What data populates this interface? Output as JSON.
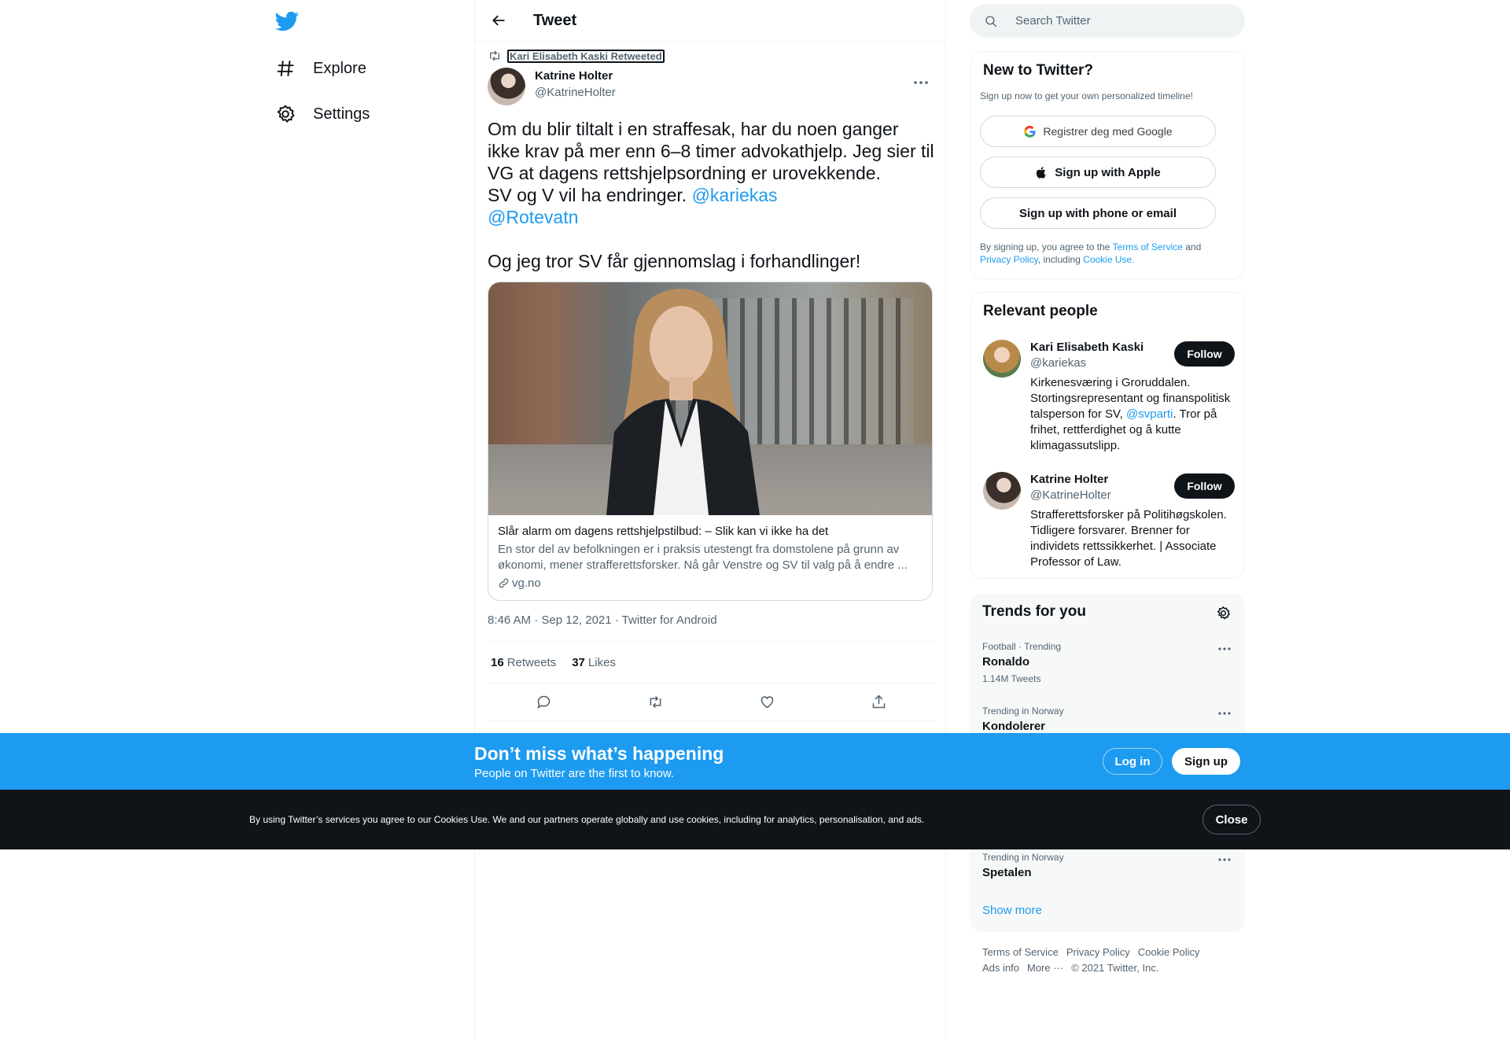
{
  "colors": {
    "accent": "#1d9bf0",
    "text": "#0f1419",
    "muted": "#536471",
    "dark": "#0f1419"
  },
  "nav": {
    "logo_icon": "twitter-bird-icon",
    "items": [
      {
        "label": "Explore",
        "icon": "hashtag-icon"
      },
      {
        "label": "Settings",
        "icon": "gear-icon"
      }
    ]
  },
  "header": {
    "title": "Tweet",
    "back_icon": "arrow-left-icon"
  },
  "tweet": {
    "retweeted_by": "Kari Elisabeth Kaski Retweeted",
    "author_name": "Katrine Holter",
    "author_handle": "@KatrineHolter",
    "text_line1": "Om du blir tiltalt i en straffesak, har du noen ganger ikke krav på mer enn 6–8 timer advokathjelp. Jeg sier til VG at dagens rettshjelpsordning er urovekkende.",
    "text_line2": "SV og V vil ha endringer. ",
    "mention1": "@kariekas",
    "mention2": "@Rotevatn",
    "text_line3": "Og jeg tror SV får gjennomslag i forhandlinger!",
    "card": {
      "title": "Slår alarm om dagens rettshjelpstilbud: – Slik kan vi ikke ha det",
      "description": "En stor del av befolkningen er i praksis utestengt fra domstolene på grunn av økonomi, mener strafferettsforsker. Nå går Venstre og SV til valg på å endre ...",
      "domain": "vg.no"
    },
    "meta": "8:46 AM · Sep 12, 2021 · Twitter for Android",
    "retweets_count": "16",
    "retweets_label": "Retweets",
    "likes_count": "37",
    "likes_label": "Likes"
  },
  "search": {
    "placeholder": "Search Twitter"
  },
  "new_to_twitter": {
    "title": "New to Twitter?",
    "subtitle": "Sign up now to get your own personalized timeline!",
    "google_label": "Registrer deg med Google",
    "apple_label": "Sign up with Apple",
    "phone_label": "Sign up with phone or email",
    "terms_prefix": "By signing up, you agree to the ",
    "terms_link": "Terms of Service",
    "terms_and": " and ",
    "privacy_link": "Privacy Policy",
    "terms_including": ", including ",
    "cookie_link": "Cookie Use."
  },
  "relevant_people": {
    "title": "Relevant people",
    "people": [
      {
        "name": "Kari Elisabeth Kaski",
        "handle": "@kariekas",
        "bio_before": "Kirkenesværing i Groruddalen. Stortingsrepresentant og finanspolitisk talsperson for SV, ",
        "bio_mention": "@svparti",
        "bio_after": ". Tror på frihet, rettferdighet og å kutte klimagassutslipp.",
        "follow_label": "Follow"
      },
      {
        "name": "Katrine Holter",
        "handle": "@KatrineHolter",
        "bio_before": "Strafferettsforsker på Politihøgskolen. Tidligere forsvarer. Brenner for individets rettssikkerhet. | Associate Professor of Law.",
        "bio_mention": "",
        "bio_after": "",
        "follow_label": "Follow"
      }
    ]
  },
  "trends": {
    "title": "Trends for you",
    "items": [
      {
        "meta": "Football · Trending",
        "name": "Ronaldo",
        "count": "1.14M Tweets"
      },
      {
        "meta": "Trending in Norway",
        "name": "Kondolerer",
        "count": ""
      },
      {
        "meta": "Trending in Norway",
        "name": "Spetalen",
        "count": ""
      }
    ],
    "show_more": "Show more"
  },
  "footer": {
    "links": [
      "Terms of Service",
      "Privacy Policy",
      "Cookie Policy",
      "Ads info",
      "More ···"
    ],
    "copyright": "© 2021 Twitter, Inc."
  },
  "bottom_bar": {
    "title": "Don’t miss what’s happening",
    "subtitle": "People on Twitter are the first to know.",
    "login_label": "Log in",
    "signup_label": "Sign up"
  },
  "cookie_bar": {
    "text": "By using Twitter’s services you agree to our Cookies Use. We and our partners operate globally and use cookies, including for analytics, personalisation, and ads.",
    "close_label": "Close"
  }
}
